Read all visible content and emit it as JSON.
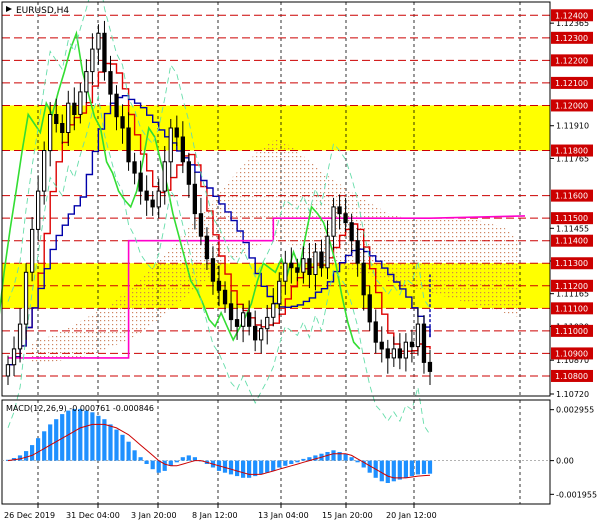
{
  "chart_data": [
    {
      "type": "candlestick",
      "symbol": "EURUSD,H4",
      "ylim": [
        1.1072,
        1.1245
      ],
      "grid": "dashed",
      "price_ticks": [
        "1.12365",
        "1.11910",
        "1.11765",
        "1.11455",
        "1.11310",
        "1.11165",
        "1.11020",
        "1.10870",
        "1.10720"
      ],
      "resistance_levels": [
        {
          "label": "1.12400",
          "value": 1.124
        },
        {
          "label": "1.12300",
          "value": 1.123
        },
        {
          "label": "1.12200",
          "value": 1.122
        },
        {
          "label": "1.12100",
          "value": 1.121
        },
        {
          "label": "1.12000",
          "value": 1.12
        },
        {
          "label": "1.11800",
          "value": 1.118
        },
        {
          "label": "1.11600",
          "value": 1.116
        },
        {
          "label": "1.11500",
          "value": 1.115
        },
        {
          "label": "1.11400",
          "value": 1.114
        },
        {
          "label": "1.11300",
          "value": 1.113
        },
        {
          "label": "1.11200",
          "value": 1.112
        },
        {
          "label": "1.11100",
          "value": 1.111
        },
        {
          "label": "1.11000",
          "value": 1.11
        },
        {
          "label": "1.10900",
          "value": 1.109
        },
        {
          "label": "1.10800",
          "value": 1.108
        }
      ],
      "zones": [
        {
          "from": 1.118,
          "to": 1.12,
          "color": "#ffff00"
        },
        {
          "from": 1.111,
          "to": 1.113,
          "color": "#ffff00"
        }
      ],
      "close_series": [
        1.1085,
        1.1092,
        1.1103,
        1.1126,
        1.1145,
        1.1162,
        1.118,
        1.1196,
        1.1192,
        1.1188,
        1.1201,
        1.1196,
        1.1206,
        1.1215,
        1.1225,
        1.1232,
        1.1215,
        1.1205,
        1.1195,
        1.119,
        1.1175,
        1.117,
        1.1162,
        1.1158,
        1.1155,
        1.1162,
        1.1175,
        1.119,
        1.1186,
        1.1175,
        1.1165,
        1.1152,
        1.1142,
        1.1132,
        1.1122,
        1.1118,
        1.1112,
        1.1105,
        1.1102,
        1.1108,
        1.1102,
        1.1096,
        1.1101,
        1.1106,
        1.1112,
        1.1122,
        1.113,
        1.1128,
        1.1126,
        1.1132,
        1.1125,
        1.1135,
        1.1128,
        1.1142,
        1.1155,
        1.1152,
        1.1148,
        1.114,
        1.113,
        1.1116,
        1.1104,
        1.1095,
        1.1092,
        1.1088,
        1.1092,
        1.1088,
        1.1095,
        1.1093,
        1.1103,
        1.1086,
        1.1082
      ],
      "macd": {
        "label": "MACD(12,26,9) -0.000761 -0.000846",
        "ticks": [
          "0.002955",
          "0.00",
          "-0.001955"
        ],
        "ylim": [
          -0.0024,
          0.0034
        ],
        "histogram": [
          5e-05,
          0.00015,
          0.0003,
          0.00055,
          0.0009,
          0.0013,
          0.0017,
          0.0021,
          0.0024,
          0.0027,
          0.0029,
          0.003,
          0.003,
          0.0029,
          0.0028,
          0.0026,
          0.0024,
          0.0021,
          0.0018,
          0.0015,
          0.0011,
          0.0006,
          0.0002,
          -0.0002,
          -0.0005,
          -0.0007,
          -0.0006,
          -0.0003,
          -0.0001,
          0.0002,
          0.0003,
          0.0002,
          0.0,
          -0.0002,
          -0.0004,
          -0.0006,
          -0.0007,
          -0.0008,
          -0.0009,
          -0.001,
          -0.001,
          -0.0009,
          -0.0008,
          -0.0007,
          -0.0006,
          -0.0004,
          -0.0003,
          -0.0002,
          -0.0001,
          0.0001,
          0.0002,
          0.0003,
          0.0004,
          0.0005,
          0.0006,
          0.0005,
          0.0004,
          0.0002,
          -0.0001,
          -0.0004,
          -0.0007,
          -0.001,
          -0.0012,
          -0.0013,
          -0.0012,
          -0.0011,
          -0.001,
          -0.0009,
          -0.0008,
          -0.00078,
          -0.00076
        ],
        "signal": [
          0.0,
          5e-05,
          0.0001,
          0.0002,
          0.0003,
          0.0005,
          0.0007,
          0.0009,
          0.0011,
          0.0013,
          0.0015,
          0.0017,
          0.0019,
          0.002,
          0.0021,
          0.0021,
          0.0021,
          0.002,
          0.0019,
          0.0017,
          0.0015,
          0.0012,
          0.0009,
          0.0006,
          0.0003,
          0.0,
          -0.0002,
          -0.0003,
          -0.0003,
          -0.0002,
          -0.0001,
          0.0,
          0.0,
          -0.0001,
          -0.0002,
          -0.0003,
          -0.0004,
          -0.0005,
          -0.0006,
          -0.0007,
          -0.0008,
          -0.0008,
          -0.0008,
          -0.0007,
          -0.0006,
          -0.0005,
          -0.0004,
          -0.0003,
          -0.0002,
          -0.0001,
          0.0,
          0.0001,
          0.0002,
          0.0003,
          0.0004,
          0.0004,
          0.0004,
          0.0003,
          0.0001,
          -0.0001,
          -0.0003,
          -0.0005,
          -0.0007,
          -0.0009,
          -0.001,
          -0.001,
          -0.001,
          -0.00095,
          -0.0009,
          -0.00087,
          -0.000846
        ]
      },
      "time_labels": [
        "26 Dec 2019",
        "31 Dec 04:00",
        "3 Jan 20:00",
        "8 Jan 12:00",
        "13 Jan 04:00",
        "15 Jan 20:00",
        "20 Jan 12:00"
      ],
      "colors": {
        "zone": "#ffff00",
        "level_line": "#cc0000",
        "badge": "#cc0000",
        "candle": "#000000",
        "tenkan": "#dd0000",
        "kijun": "#0000aa",
        "chikou": "#33dd33",
        "envelope": "#66ddaa",
        "magenta": "#ff00cc",
        "cloud": "#c87850",
        "macd_hist": "#1e90ff",
        "macd_signal": "#cc0000"
      }
    }
  ]
}
